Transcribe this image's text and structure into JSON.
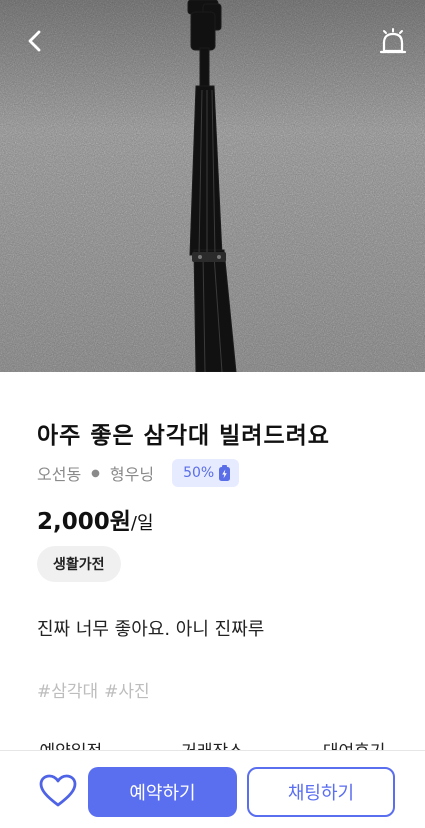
{
  "header": {
    "back_icon": "chevron-left-icon",
    "alarm_icon": "alarm-bell-icon",
    "photo_subject": "tripod-photo"
  },
  "listing": {
    "title": "아주 좋은 삼각대 빌려드려요",
    "location": "오선동",
    "seller": "형우닝",
    "battery": "50%",
    "price": "2,000원",
    "price_unit": "/일",
    "category": "생활가전",
    "description": "진짜 너무 좋아요. 아니 진짜루",
    "hashtags": [
      "#삼각대",
      "#사진"
    ]
  },
  "tabs": [
    {
      "label": "예약일정"
    },
    {
      "label": "거래장소"
    },
    {
      "label": "대여후기"
    }
  ],
  "actions": {
    "like_icon": "heart-icon",
    "reserve_label": "예약하기",
    "chat_label": "채팅하기"
  },
  "colors": {
    "accent": "#5a6ef0",
    "badge_bg": "#e6ebff",
    "chip_bg": "#f0f0f0",
    "hashtag": "#bdbdbd"
  }
}
